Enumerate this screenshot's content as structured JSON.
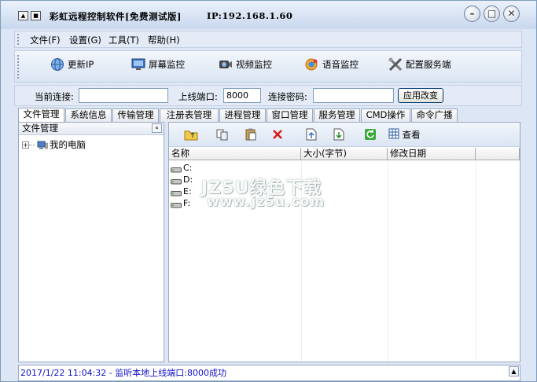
{
  "window": {
    "title": "彩虹远程控制软件[免费测试版]",
    "ip": "IP:192.168.1.60"
  },
  "menu": [
    "文件(F)",
    "设置(G)",
    "工具(T)",
    "帮助(H)"
  ],
  "toolbar": [
    {
      "label": "更新IP",
      "icon": "globe-icon"
    },
    {
      "label": "屏幕监控",
      "icon": "monitor-icon"
    },
    {
      "label": "视频监控",
      "icon": "camera-icon"
    },
    {
      "label": "语音监控",
      "icon": "voice-icon"
    },
    {
      "label": "配置服务端",
      "icon": "tools-icon"
    }
  ],
  "connection": {
    "current_label": "当前连接:",
    "current_value": "",
    "port_label": "上线端口:",
    "port_value": "8000",
    "password_label": "连接密码:",
    "password_value": "",
    "apply_label": "应用改变"
  },
  "tabs": [
    "文件管理",
    "系统信息",
    "传输管理",
    "注册表管理",
    "进程管理",
    "窗口管理",
    "服务管理",
    "CMD操作",
    "命令广播"
  ],
  "active_tab": "文件管理",
  "left_pane": {
    "title": "文件管理",
    "collapse": "«",
    "tree": [
      {
        "expander": "+",
        "label": "我的电脑"
      }
    ]
  },
  "file_toolbar": {
    "buttons": [
      "up-folder-icon",
      "copy-icon",
      "paste-icon",
      "delete-icon",
      "upload-icon",
      "download-icon",
      "refresh-icon"
    ],
    "view_label": "查看"
  },
  "file_list": {
    "columns": [
      "名称",
      "大小(字节)",
      "修改日期"
    ],
    "rows": [
      "C:",
      "D:",
      "E:",
      "F:"
    ]
  },
  "watermark": {
    "line1": "JZ5U绿色下载",
    "line2": "www.jz5u.com"
  },
  "log": {
    "text": "2017/1/22 11:04:32 - 监听本地上线端口:8000成功"
  },
  "colors": {
    "title_bg": "#c9d8ee",
    "window_bg": "#dde6f4",
    "log_text": "#1010c8",
    "delete_red": "#d81818"
  }
}
